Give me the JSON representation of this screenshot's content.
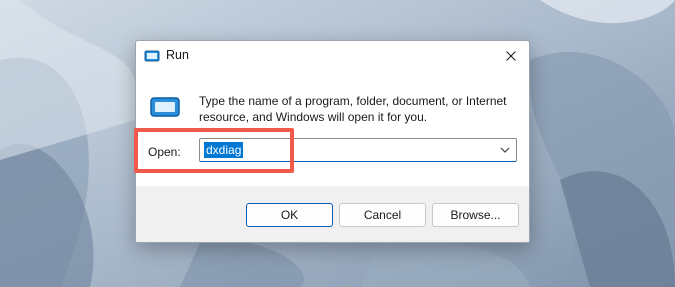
{
  "window": {
    "title": "Run",
    "close_icon": "close-icon",
    "app_icon": "run-icon"
  },
  "body": {
    "description": "Type the name of a program, folder, document, or Internet resource, and Windows will open it for you.",
    "open_label": "Open:",
    "open_value": "dxdiag",
    "dropdown_icon": "chevron-down-icon"
  },
  "buttons": {
    "ok": "OK",
    "cancel": "Cancel",
    "browse": "Browse..."
  },
  "colors": {
    "accent": "#0078d4",
    "highlight_border": "#f15a4a"
  }
}
